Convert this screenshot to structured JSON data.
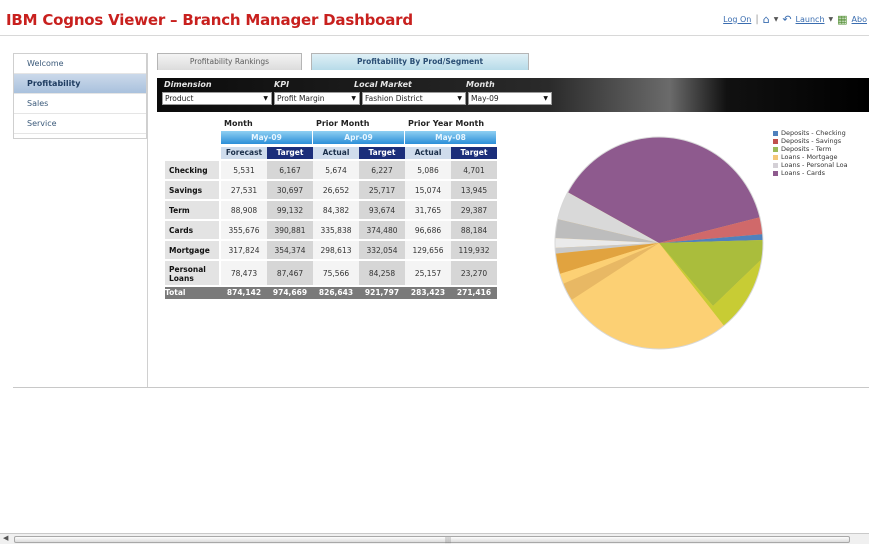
{
  "header": {
    "title": "IBM Cognos Viewer – Branch Manager Dashboard",
    "log_on": "Log On",
    "launch": "Launch",
    "about": "Abo",
    "icons": [
      "home-icon",
      "back-icon",
      "launch-icon",
      "about-icon"
    ]
  },
  "nav": {
    "items": [
      {
        "label": "Welcome"
      },
      {
        "label": "Profitability"
      },
      {
        "label": "Sales"
      },
      {
        "label": "Service"
      }
    ]
  },
  "tabs": [
    {
      "label": "Profitability Rankings"
    },
    {
      "label": "Profitability By Prod/Segment"
    }
  ],
  "prompts": {
    "labels": [
      "Dimension",
      "KPI",
      "Local Market",
      "Month"
    ],
    "values": [
      "Product",
      "Profit Margin",
      "Fashion District",
      "May-09"
    ]
  },
  "crosstab": {
    "groups": [
      "Month",
      "Prior Month",
      "Prior Year Month"
    ],
    "months": [
      "May-09",
      "Apr-09",
      "May-08"
    ],
    "subheaders": [
      "Forecast",
      "Target",
      "Actual",
      "Target",
      "Actual",
      "Target"
    ],
    "rows": [
      {
        "label": "Checking",
        "values": [
          "5,531",
          "6,167",
          "5,674",
          "6,227",
          "5,086",
          "4,701"
        ]
      },
      {
        "label": "Savings",
        "values": [
          "27,531",
          "30,697",
          "26,652",
          "25,717",
          "15,074",
          "13,945"
        ]
      },
      {
        "label": "Term",
        "values": [
          "88,908",
          "99,132",
          "84,382",
          "93,674",
          "31,765",
          "29,387"
        ]
      },
      {
        "label": "Cards",
        "values": [
          "355,676",
          "390,881",
          "335,838",
          "374,480",
          "96,686",
          "88,184"
        ]
      },
      {
        "label": "Mortgage",
        "values": [
          "317,824",
          "354,374",
          "298,613",
          "332,054",
          "129,656",
          "119,932"
        ]
      },
      {
        "label": "Personal Loans",
        "values": [
          "78,473",
          "87,467",
          "75,566",
          "84,258",
          "25,157",
          "23,270"
        ]
      }
    ],
    "total": {
      "label": "Total",
      "values": [
        "874,142",
        "974,669",
        "826,643",
        "921,797",
        "283,423",
        "271,416"
      ]
    }
  },
  "legend": [
    {
      "label": "Deposits - Checking",
      "color": "#4f81bd"
    },
    {
      "label": "Deposits - Savings",
      "color": "#c0504d"
    },
    {
      "label": "Deposits - Term",
      "color": "#9bbb59"
    },
    {
      "label": "Loans - Mortgage",
      "color": "#f4c87a"
    },
    {
      "label": "Loans - Personal Loa",
      "color": "#d4d0d6"
    },
    {
      "label": "Loans - Cards",
      "color": "#8e5a8e"
    }
  ],
  "colors": {
    "title_red": "#c8201e",
    "link_blue": "#3a6db0",
    "header_navy": "#1b2e7a"
  }
}
